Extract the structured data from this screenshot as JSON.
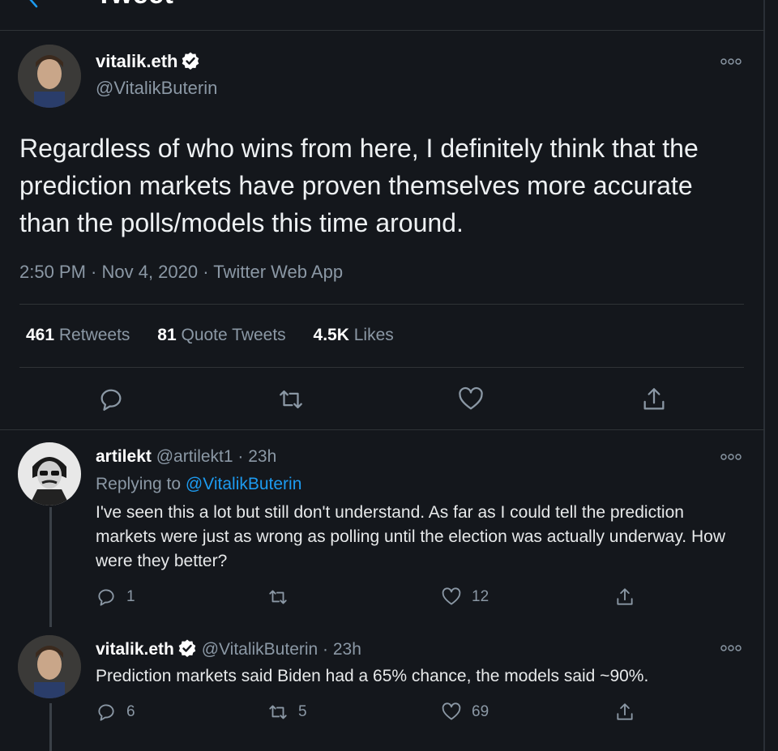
{
  "header": {
    "title": "Tweet"
  },
  "main_tweet": {
    "display_name": "vitalik.eth",
    "handle": "@VitalikButerin",
    "text": "Regardless of who wins from here, I definitely think that the prediction markets have proven themselves more accurate than the polls/models this time around.",
    "timestamp": "2:50 PM · Nov 4, 2020 · Twitter Web App",
    "stats": {
      "retweets_count": "461",
      "retweets_label": "Retweets",
      "quotes_count": "81",
      "quotes_label": "Quote Tweets",
      "likes_count": "4.5K",
      "likes_label": "Likes"
    }
  },
  "replies": [
    {
      "display_name": "artilekt",
      "meta": "@artilekt1 · 23h",
      "replying_prefix": "Replying to",
      "replying_to": "@VitalikButerin",
      "text": "I've seen this a lot but still don't understand. As far as I could tell the prediction markets were just as wrong as polling until the election was actually underway. How were they better?",
      "reply_count": "1",
      "retweet_count": "",
      "like_count": "12"
    },
    {
      "display_name": "vitalik.eth",
      "meta": "@VitalikButerin · 23h",
      "text": "Prediction markets said Biden had a 65% chance, the models said ~90%.",
      "reply_count": "6",
      "retweet_count": "5",
      "like_count": "69"
    }
  ],
  "colors": {
    "background": "#14171c",
    "accent": "#1d9bf0",
    "muted": "#8b98a5",
    "verified": "#ffffff"
  },
  "icons": [
    "back-arrow-icon",
    "verified-icon",
    "more-icon",
    "reply-icon",
    "retweet-icon",
    "like-icon",
    "share-icon"
  ]
}
